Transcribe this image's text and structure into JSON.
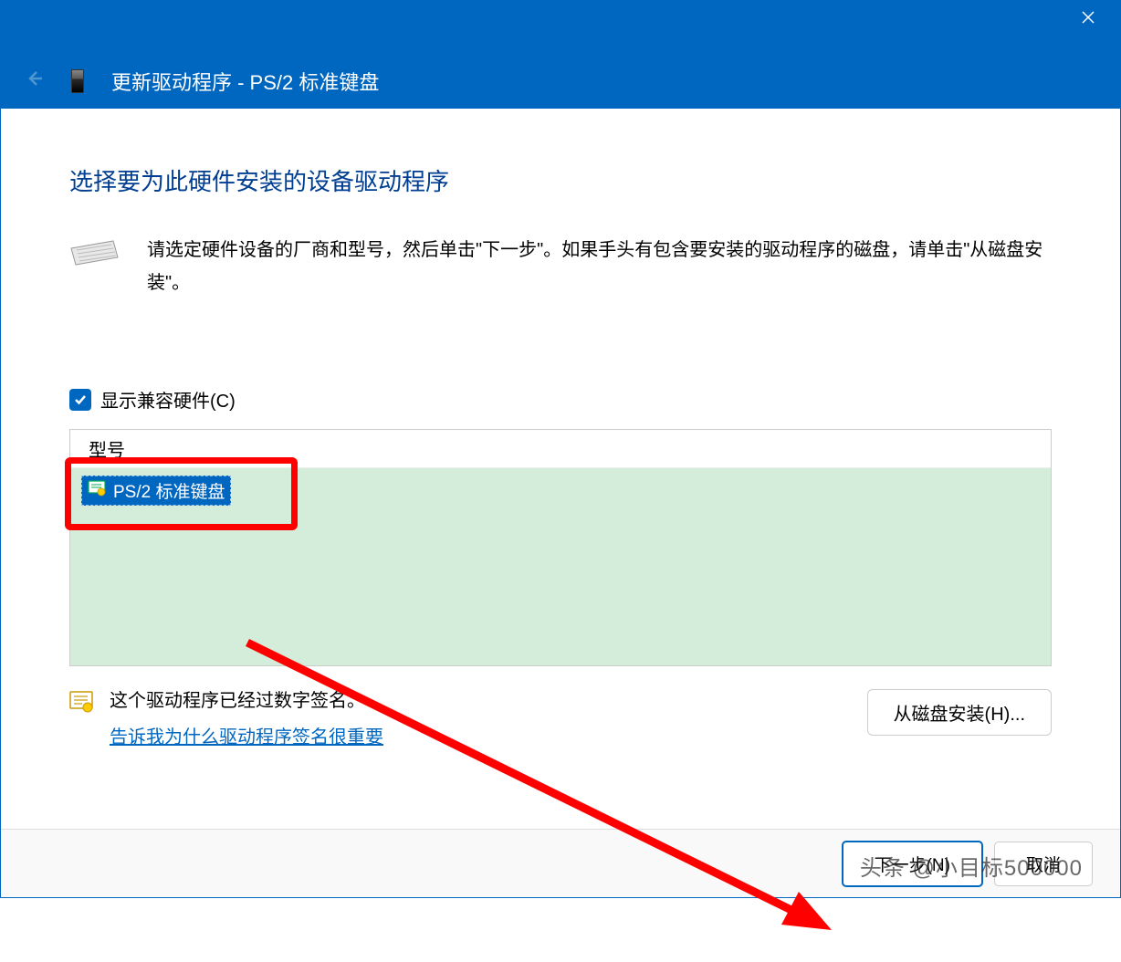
{
  "titlebar": {
    "window_title": "更新驱动程序 - PS/2 标准键盘"
  },
  "content": {
    "heading": "选择要为此硬件安装的设备驱动程序",
    "instruction": "请选定硬件设备的厂商和型号，然后单击\"下一步\"。如果手头有包含要安装的驱动程序的磁盘，请单击\"从磁盘安装\"。",
    "compatible_checkbox_label": "显示兼容硬件(C)",
    "list_header": "型号",
    "list_items": [
      {
        "label": "PS/2 标准键盘",
        "selected": true
      }
    ],
    "cert_message": "这个驱动程序已经过数字签名。",
    "cert_link": "告诉我为什么驱动程序签名很重要",
    "disk_install_button": "从磁盘安装(H)..."
  },
  "buttons": {
    "next": "下一步(N)",
    "cancel": "取消"
  },
  "watermark": "头条 @小目标500000"
}
